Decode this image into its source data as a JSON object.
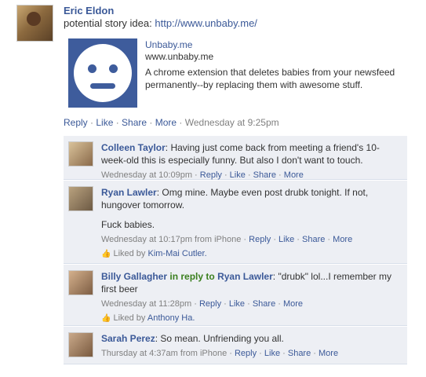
{
  "post": {
    "author": "Eric Eldon",
    "text_prefix": "potential story idea: ",
    "link": "http://www.unbaby.me/",
    "attachment": {
      "title": "Unbaby.me",
      "url": "www.unbaby.me",
      "description": "A chrome extension that deletes babies from your newsfeed permanently--by replacing them with awesome stuff."
    },
    "actions": [
      "Reply",
      "Like",
      "Share",
      "More"
    ],
    "timestamp": "Wednesday at 9:25pm"
  },
  "comments": [
    {
      "author": "Colleen Taylor",
      "text": "Having just come back from meeting a friend's 10-week-old this is especially funny. But also I don't want to touch.",
      "meta": "Wednesday at 10:09pm",
      "actions": [
        "Reply",
        "Like",
        "Share",
        "More"
      ]
    },
    {
      "author": "Ryan Lawler",
      "text": "Omg mine. Maybe even post drubk tonight. If not, hungover tomorrow.",
      "text2": "Fuck babies.",
      "meta": "Wednesday at 10:17pm from iPhone",
      "actions": [
        "Reply",
        "Like",
        "Share",
        "More"
      ],
      "liked_by_prefix": "Liked by ",
      "liked_by": "Kim-Mai Cutler."
    },
    {
      "author": "Billy Gallagher",
      "reply_word": "in reply to",
      "reply_to": "Ryan Lawler",
      "text": "\"drubk\" lol...I remember my first beer",
      "meta": "Wednesday at 11:28pm",
      "actions": [
        "Reply",
        "Like",
        "Share",
        "More"
      ],
      "liked_by_prefix": "Liked by ",
      "liked_by": "Anthony Ha."
    },
    {
      "author": "Sarah Perez",
      "text": "So mean. Unfriending you all.",
      "meta": "Thursday at 4:37am from iPhone",
      "actions": [
        "Reply",
        "Like",
        "Share",
        "More"
      ]
    }
  ],
  "separator": " · ",
  "icons": {
    "like_thumb": "thumbs-up-icon",
    "attachment": "smiley-face-icon"
  },
  "colors": {
    "link": "#3b5998",
    "comment_bg": "#edeff4",
    "reply_green": "#3a7f1e",
    "muted": "#808080"
  }
}
